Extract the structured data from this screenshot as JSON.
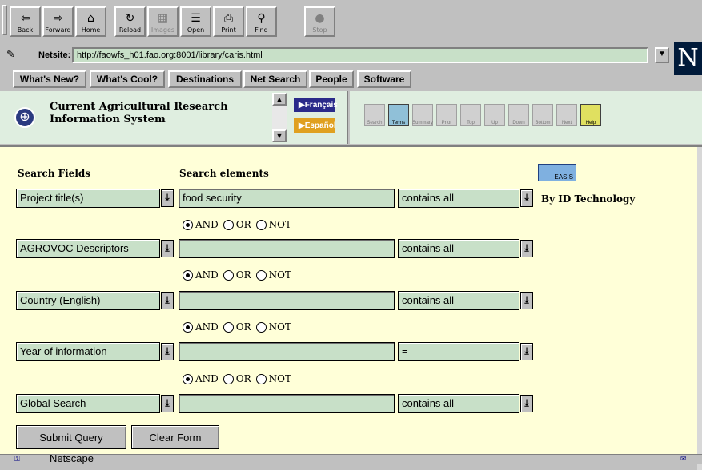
{
  "toolbar": {
    "buttons": [
      {
        "label": "Back",
        "icon": "⇦"
      },
      {
        "label": "Forward",
        "icon": "⇨"
      },
      {
        "label": "Home",
        "icon": "⌂"
      },
      {
        "label": "Reload",
        "icon": "↻"
      },
      {
        "label": "Images",
        "icon": "▦"
      },
      {
        "label": "Open",
        "icon": "☰"
      },
      {
        "label": "Print",
        "icon": "⎙"
      },
      {
        "label": "Find",
        "icon": "⚲"
      },
      {
        "label": "Stop",
        "icon": "●"
      }
    ]
  },
  "location": {
    "label": "Netsite:",
    "url": "http://faowfs_h01.fao.org:8001/library/caris.html"
  },
  "logo": "N",
  "directory": [
    "What's New?",
    "What's Cool?",
    "Destinations",
    "Net Search",
    "People",
    "Software"
  ],
  "caris": {
    "title_line1": "Current Agricultural Research",
    "title_line2": "Information System",
    "lang_fr": "Français",
    "lang_es": "Español"
  },
  "nav_buttons": [
    "Search",
    "Terms",
    "Summary",
    "Prior",
    "Top",
    "Up",
    "Down",
    "Bottom",
    "Next",
    "Help"
  ],
  "form": {
    "header_fields": "Search Fields",
    "header_elements": "Search elements",
    "easis_label": "EASIS",
    "by_id_technology": "By ID Technology",
    "rows": [
      {
        "field": "Project title(s)",
        "value": "food security",
        "operator": "contains all"
      },
      {
        "field": "AGROVOC Descriptors",
        "value": "",
        "operator": "contains all"
      },
      {
        "field": "Country (English)",
        "value": "",
        "operator": "contains all"
      },
      {
        "field": "Year of information",
        "value": "",
        "operator": "="
      },
      {
        "field": "Global Search",
        "value": "",
        "operator": "contains all"
      }
    ],
    "boolean": {
      "and": "AND",
      "or": "OR",
      "not": "NOT"
    },
    "submit": "Submit Query",
    "clear": "Clear Form"
  },
  "status": {
    "text": "Netscape"
  }
}
